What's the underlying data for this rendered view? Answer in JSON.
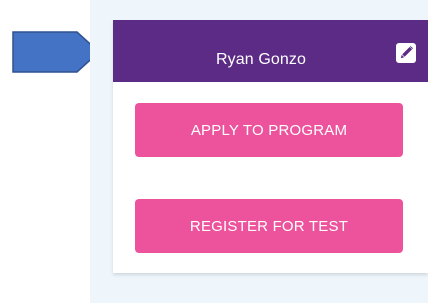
{
  "annotation": {
    "arrow_color": "#4472c4",
    "arrow_outline": "#2f528f"
  },
  "profile": {
    "name": "Ryan Gonzo",
    "header_color": "#5c2b86",
    "edit_icon": "pencil-edit-icon"
  },
  "actions": {
    "apply_label": "APPLY TO PROGRAM",
    "register_label": "REGISTER FOR TEST",
    "button_color": "#ec539c"
  },
  "panel": {
    "background": "#eef6fc"
  }
}
